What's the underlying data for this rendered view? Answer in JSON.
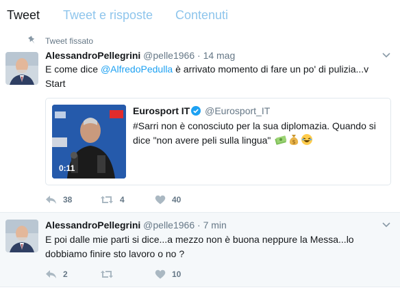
{
  "tabs": [
    {
      "label": "Tweet",
      "active": true
    },
    {
      "label": "Tweet e risposte",
      "active": false
    },
    {
      "label": "Contenuti",
      "active": false
    }
  ],
  "tweets": [
    {
      "pinned_label": "Tweet fissato",
      "name": "AlessandroPellegrini",
      "handle": "@pelle1966",
      "separator": "·",
      "time": "14 mag",
      "text_before": "E come dice ",
      "mention": "@AlfredoPedulla",
      "text_after": " è arrivato momento di fare un po' di pulizia...v Start",
      "quote": {
        "name": "Eurosport IT",
        "handle": "@Eurosport_IT",
        "text": "#Sarri non è conosciuto per la sua diplomazia. Quando si dice \"non avere peli sulla lingua\"",
        "duration": "0:11"
      },
      "replies": "38",
      "retweets": "4",
      "likes": "40"
    },
    {
      "name": "AlessandroPellegrini",
      "handle": "@pelle1966",
      "separator": "·",
      "time": "7 min",
      "text": "E poi dalle mie parti si dice...a mezzo non è buona neppure la Messa...lo dobbiamo finire sto lavoro o no ?",
      "replies": "2",
      "retweets": "",
      "likes": "10"
    }
  ],
  "colors": {
    "link": "#1da1f2",
    "muted": "#657786",
    "tab_inactive": "#8ec5ec"
  },
  "icons": [
    "pin-icon",
    "caret-down-icon",
    "verified-icon",
    "reply-icon",
    "retweet-icon",
    "heart-icon",
    "money-emoji",
    "moneybag-emoji",
    "laughing-emoji"
  ]
}
